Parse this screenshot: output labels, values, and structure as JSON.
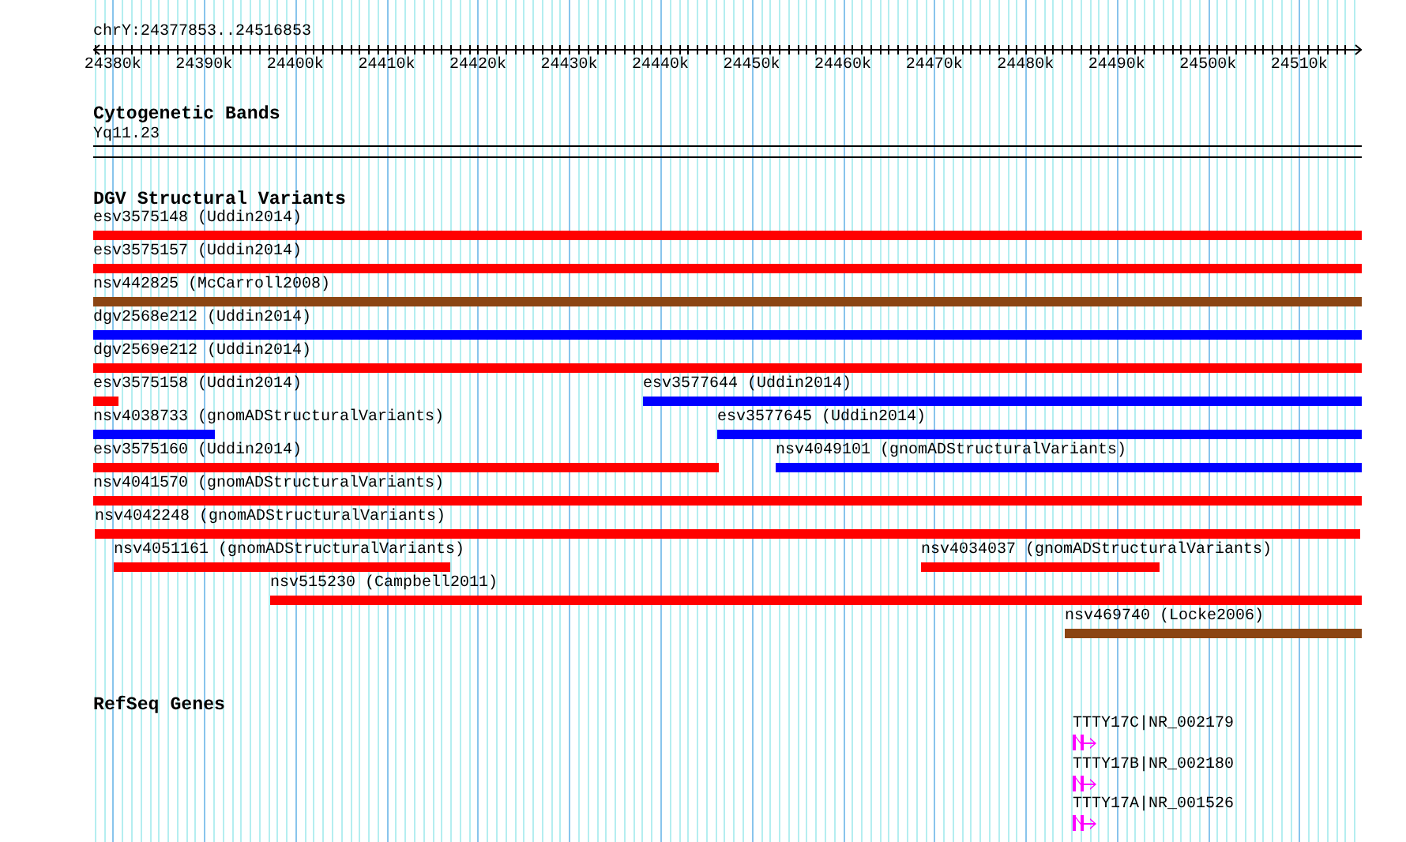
{
  "ruler": {
    "region": "chrY:24377853..24516853",
    "ticks": [
      {
        "label": "24380k"
      },
      {
        "label": "24390k"
      },
      {
        "label": "24400k"
      },
      {
        "label": "24410k"
      },
      {
        "label": "24420k"
      },
      {
        "label": "24430k"
      },
      {
        "label": "24440k"
      },
      {
        "label": "24450k"
      },
      {
        "label": "24460k"
      },
      {
        "label": "24470k"
      },
      {
        "label": "24480k"
      },
      {
        "label": "24490k"
      },
      {
        "label": "24500k"
      },
      {
        "label": "24510k"
      }
    ]
  },
  "tracks": [
    {
      "kind": "bands",
      "title": "Cytogenetic Bands",
      "bands": [
        {
          "label": "Yq11.23"
        }
      ]
    },
    {
      "kind": "variants",
      "title": "DGV Structural Variants",
      "rows": [
        {
          "features": [
            {
              "label": "esv3575148 (Uddin2014)",
              "color": "#ff0000"
            }
          ]
        },
        {
          "features": [
            {
              "label": "esv3575157 (Uddin2014)",
              "color": "#ff0000"
            }
          ]
        },
        {
          "features": [
            {
              "label": "nsv442825 (McCarroll2008)",
              "color": "#8b4513"
            }
          ]
        },
        {
          "features": [
            {
              "label": "dgv2568e212 (Uddin2014)",
              "color": "#0000ff"
            }
          ]
        },
        {
          "features": [
            {
              "label": "dgv2569e212 (Uddin2014)",
              "color": "#ff0000"
            }
          ]
        },
        {
          "features": [
            {
              "label": "esv3575158 (Uddin2014)",
              "color": "#ff0000"
            },
            {
              "label": "esv3577644 (Uddin2014)",
              "color": "#0000ff"
            }
          ]
        },
        {
          "features": [
            {
              "label": "nsv4038733 (gnomADStructuralVariants)",
              "color": "#0000ff"
            },
            {
              "label": "esv3577645 (Uddin2014)",
              "color": "#0000ff"
            }
          ]
        },
        {
          "features": [
            {
              "label": "esv3575160 (Uddin2014)",
              "color": "#ff0000"
            },
            {
              "label": "nsv4049101 (gnomADStructuralVariants)",
              "color": "#0000ff"
            }
          ]
        },
        {
          "features": [
            {
              "label": "nsv4041570 (gnomADStructuralVariants)",
              "color": "#ff0000"
            }
          ]
        },
        {
          "features": [
            {
              "label": "nsv4042248 (gnomADStructuralVariants)",
              "color": "#ff0000"
            }
          ]
        },
        {
          "features": [
            {
              "label": "nsv4051161 (gnomADStructuralVariants)",
              "color": "#ff0000"
            },
            {
              "label": "nsv4034037 (gnomADStructuralVariants)",
              "color": "#ff0000"
            }
          ]
        },
        {
          "features": [
            {
              "label": "nsv515230 (Campbell2011)",
              "color": "#ff0000"
            }
          ]
        },
        {
          "features": [
            {
              "label": "nsv469740 (Locke2006)",
              "color": "#8b4513"
            }
          ]
        }
      ]
    },
    {
      "kind": "genes",
      "title": "RefSeq Genes",
      "genes": [
        {
          "label": "TTTY17C|NR_002179"
        },
        {
          "label": "TTTY17B|NR_002180"
        },
        {
          "label": "TTTY17A|NR_001526"
        }
      ]
    }
  ]
}
